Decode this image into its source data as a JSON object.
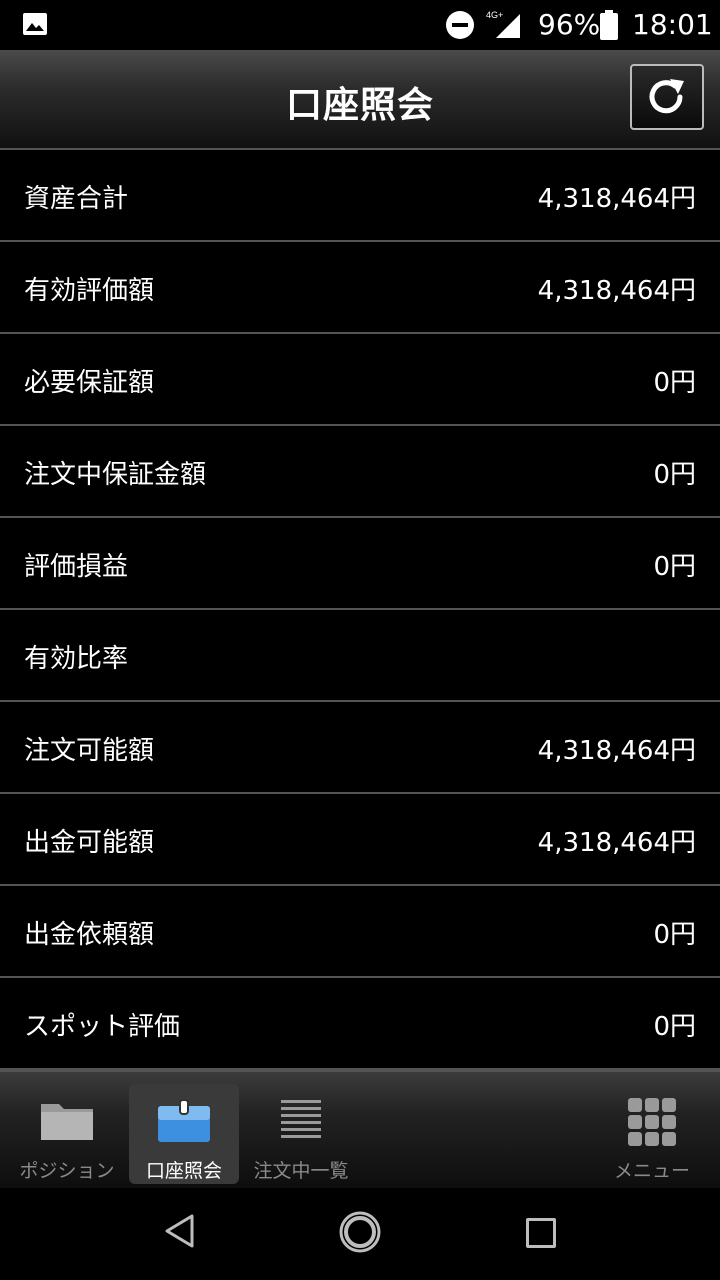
{
  "status_bar": {
    "network": "4G+",
    "battery_percent": "96%",
    "time": "18:01"
  },
  "header": {
    "title": "口座照会",
    "refresh_icon": "refresh-icon"
  },
  "rows": [
    {
      "label": "資産合計",
      "value": "4,318,464円"
    },
    {
      "label": "有効評価額",
      "value": "4,318,464円"
    },
    {
      "label": "必要保証額",
      "value": "0円"
    },
    {
      "label": "注文中保証金額",
      "value": "0円"
    },
    {
      "label": "評価損益",
      "value": "0円"
    },
    {
      "label": "有効比率",
      "value": ""
    },
    {
      "label": "注文可能額",
      "value": "4,318,464円"
    },
    {
      "label": "出金可能額",
      "value": "4,318,464円"
    },
    {
      "label": "出金依頼額",
      "value": "0円"
    },
    {
      "label": "スポット評価",
      "value": "0円"
    }
  ],
  "tabs": [
    {
      "label": "ポジション",
      "icon": "folder-icon",
      "active": false
    },
    {
      "label": "口座照会",
      "icon": "briefcase-icon",
      "active": true
    },
    {
      "label": "注文中一覧",
      "icon": "list-icon",
      "active": false
    },
    {
      "label": "メニュー",
      "icon": "grid-icon",
      "active": false
    }
  ],
  "colors": {
    "background": "#000000",
    "divider": "#555555",
    "active_tab_icon": "#3d8fe0",
    "inactive_tab_text": "#8a8a8a"
  }
}
